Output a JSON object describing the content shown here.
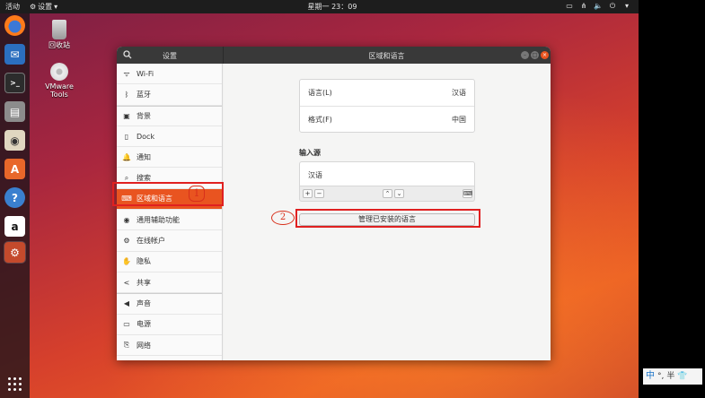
{
  "topbar": {
    "activities": "活动",
    "app_menu": "设置",
    "clock": "星期一 23：09"
  },
  "desktop": {
    "icons": [
      {
        "label": "回收站"
      },
      {
        "label": "VMware Tools"
      }
    ]
  },
  "window": {
    "sidebar_title": "设置",
    "main_title": "区域和语言"
  },
  "sidebar": {
    "items": [
      {
        "label": "Wi-Fi",
        "icon": "wifi-icon"
      },
      {
        "label": "蓝牙",
        "icon": "bluetooth-icon"
      },
      {
        "label": "背景",
        "icon": "background-icon"
      },
      {
        "label": "Dock",
        "icon": "dock-icon"
      },
      {
        "label": "通知",
        "icon": "bell-icon"
      },
      {
        "label": "搜索",
        "icon": "search-icon"
      },
      {
        "label": "区域和语言",
        "icon": "keyboard-icon"
      },
      {
        "label": "通用辅助功能",
        "icon": "accessibility-icon"
      },
      {
        "label": "在线帐户",
        "icon": "online-accounts-icon"
      },
      {
        "label": "隐私",
        "icon": "privacy-icon"
      },
      {
        "label": "共享",
        "icon": "share-icon"
      },
      {
        "label": "声音",
        "icon": "speaker-icon"
      },
      {
        "label": "电源",
        "icon": "power-icon"
      },
      {
        "label": "网络",
        "icon": "network-icon"
      }
    ]
  },
  "region": {
    "language_label": "语言(L)",
    "language_value": "汉语",
    "formats_label": "格式(F)",
    "formats_value": "中国",
    "input_sources_label": "输入源",
    "input_source_item": "汉语",
    "manage_button": "管理已安装的语言"
  },
  "annotations": {
    "marker_1": "1",
    "marker_2": "2"
  },
  "ime": {
    "mode": "中",
    "punct": "°,",
    "width": "半"
  },
  "colors": {
    "accent": "#e95420",
    "annotation_red": "#e02020"
  }
}
